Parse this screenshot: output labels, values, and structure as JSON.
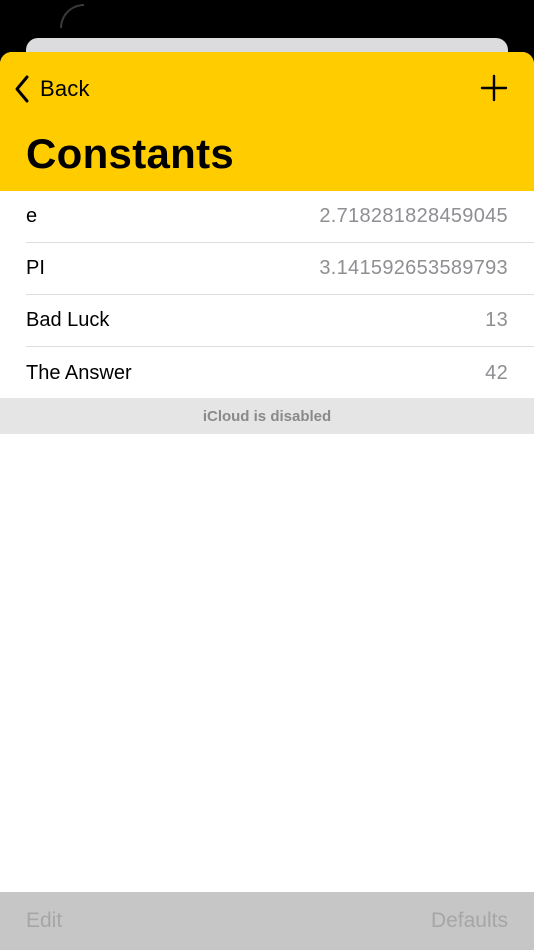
{
  "navbar": {
    "back_label": "Back",
    "title": "Constants",
    "color": "#ffcc00"
  },
  "constants": [
    {
      "name": "e",
      "value": "2.718281828459045"
    },
    {
      "name": "PI",
      "value": "3.141592653589793"
    },
    {
      "name": "Bad Luck",
      "value": "13"
    },
    {
      "name": "The Answer",
      "value": "42"
    }
  ],
  "status": {
    "icloud": "iCloud is disabled"
  },
  "toolbar": {
    "edit_label": "Edit",
    "defaults_label": "Defaults"
  },
  "icons": {
    "back": "chevron-left-icon",
    "add": "plus-icon"
  }
}
